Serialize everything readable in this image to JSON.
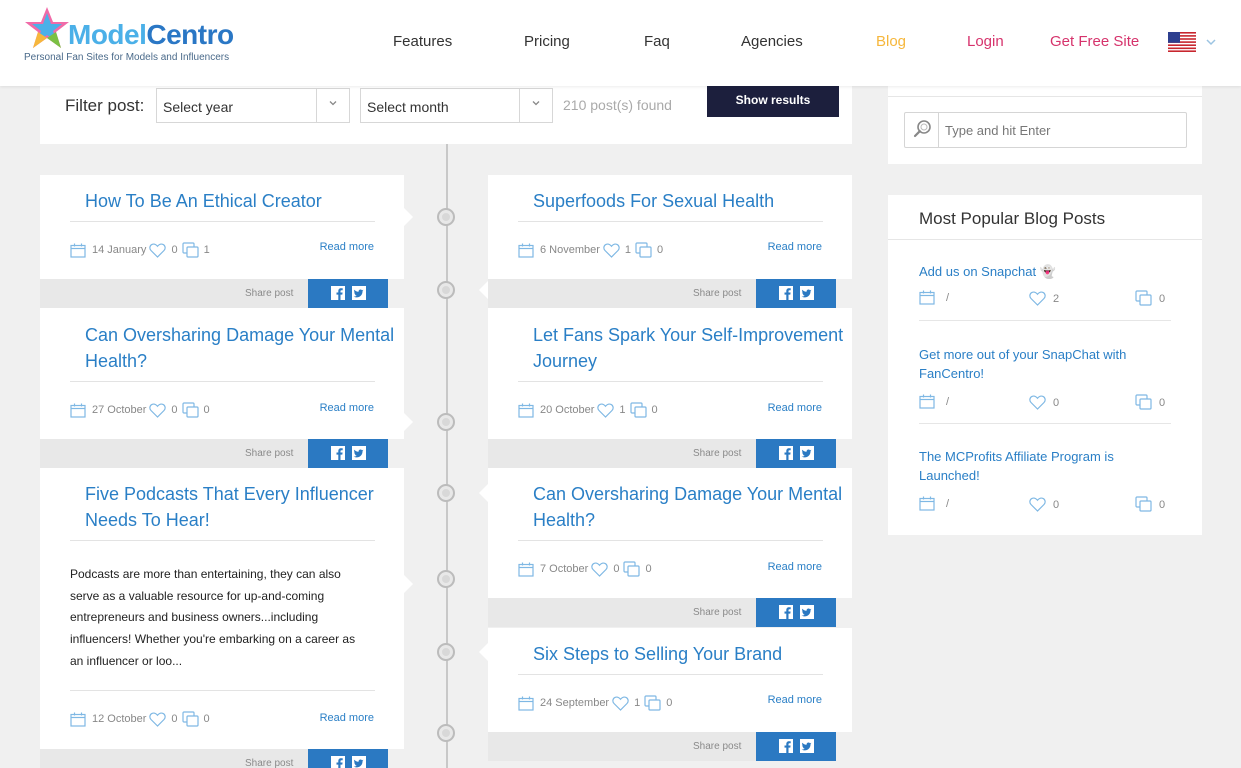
{
  "brand": {
    "name_part1": "Model",
    "name_part2": "Centro",
    "tagline": "Personal Fan Sites for Models and Influencers"
  },
  "nav": {
    "features": "Features",
    "pricing": "Pricing",
    "faq": "Faq",
    "agencies": "Agencies",
    "blog": "Blog",
    "login": "Login",
    "get_free_site": "Get Free Site",
    "active": "Blog"
  },
  "filter": {
    "label": "Filter post:",
    "year_select": "Select year",
    "month_select": "Select month",
    "found": "210 post(s) found",
    "show_button": "Show results"
  },
  "share_label": "Share post",
  "read_more": "Read more",
  "posts_left": [
    {
      "title": "How To Be An Ethical Creator",
      "date": "14 January",
      "likes": "0",
      "comments": "1"
    },
    {
      "title": "Can Oversharing Damage Your Mental Health?",
      "date": "27 October",
      "likes": "0",
      "comments": "0"
    },
    {
      "title": "Five Podcasts That Every Influencer Needs To Hear!",
      "excerpt": "Podcasts are more than entertaining, they can also serve as a valuable resource for up-and-coming entrepreneurs and business owners...including influencers! Whether you're embarking on a career as an influencer or loo...",
      "date": "12 October",
      "likes": "0",
      "comments": "0"
    }
  ],
  "posts_right": [
    {
      "title": "Superfoods For Sexual Health",
      "date": "6 November",
      "likes": "1",
      "comments": "0"
    },
    {
      "title": "Let Fans Spark Your Self-Improvement Journey",
      "date": "20 October",
      "likes": "1",
      "comments": "0"
    },
    {
      "title": "Can Oversharing Damage Your Mental Health?",
      "date": "7 October",
      "likes": "0",
      "comments": "0"
    },
    {
      "title": "Six Steps to Selling Your Brand",
      "date": "24 September",
      "likes": "1",
      "comments": "0"
    }
  ],
  "sidebar": {
    "search_placeholder": "Type and hit Enter",
    "popular_title": "Most Popular Blog Posts",
    "popular": [
      {
        "title": "Add us on Snapchat 👻",
        "date": "/",
        "likes": "2",
        "comments": "0"
      },
      {
        "title": "Get more out of your SnapChat with FanCentro!",
        "date": "/",
        "likes": "0",
        "comments": "0"
      },
      {
        "title": "The MCProfits Affiliate Program is Launched!",
        "date": "/",
        "likes": "0",
        "comments": "0"
      }
    ]
  },
  "colors": {
    "link_blue": "#2a7fc6",
    "active_nav": "#f6b73c",
    "login_pink": "#d6336c",
    "button_dark": "#1c1f3d",
    "share_blue": "#2b79c2"
  },
  "icons": [
    "search-icon",
    "calendar-icon",
    "heart-icon",
    "comment-icon",
    "facebook-icon",
    "twitter-icon",
    "us-flag-icon",
    "chevron-down-icon"
  ]
}
